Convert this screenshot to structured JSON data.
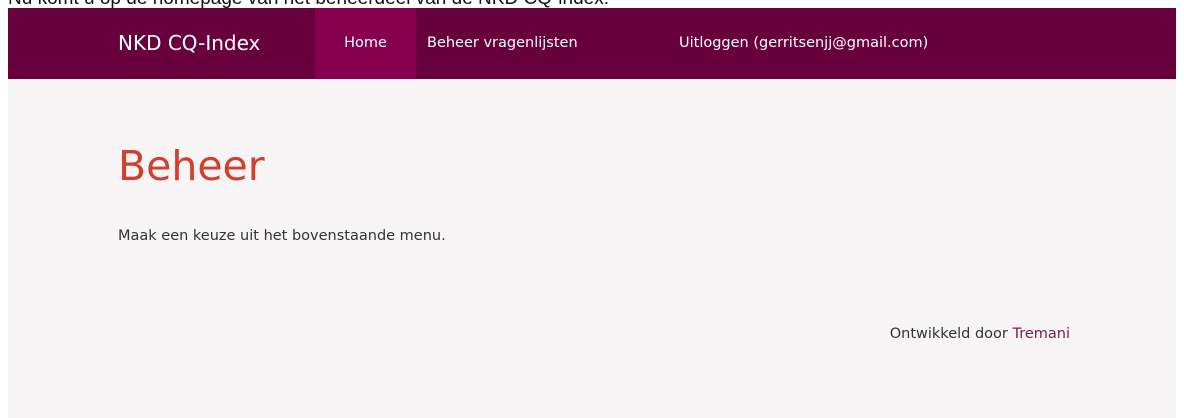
{
  "document": {
    "caption": "Nu komt u op de homepage van het beheerdeel van de NKD CQ-index."
  },
  "navbar": {
    "brand": "NKD CQ-Index",
    "items": [
      {
        "label": "Home",
        "active": true
      },
      {
        "label": "Beheer vragenlijsten",
        "active": false
      },
      {
        "label": "Uitloggen (gerritsenjj@gmail.com)",
        "active": false
      }
    ]
  },
  "main": {
    "title": "Beheer",
    "intro": "Maak een keuze uit het bovenstaande menu."
  },
  "footer": {
    "prefix": "Ontwikkeld door",
    "link": "Tremani"
  },
  "colors": {
    "navbar": "#68003e",
    "nav_active": "#86004f",
    "title": "#d1402c",
    "background": "#f6f4f4",
    "link": "#7a1a4e"
  }
}
